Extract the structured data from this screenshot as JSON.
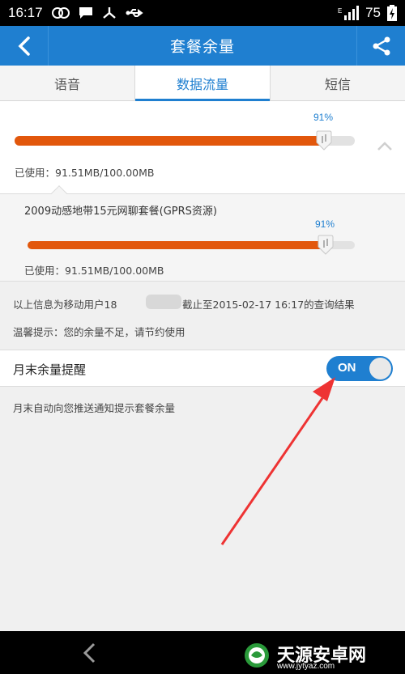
{
  "status_bar": {
    "time": "16:17",
    "battery": "75"
  },
  "app_bar": {
    "title": "套餐余量"
  },
  "tabs": [
    {
      "label": "语音",
      "active": false
    },
    {
      "label": "数据流量",
      "active": true
    },
    {
      "label": "短信",
      "active": false
    }
  ],
  "total": {
    "percent": "91%",
    "progress": 0.91,
    "used_text": "已使用：91.51MB/100.00MB"
  },
  "package": {
    "name": "2009动感地带15元网聊套餐(GPRS资源)",
    "percent": "91%",
    "progress": 0.91,
    "used_text": "已使用：91.51MB/100.00MB"
  },
  "info": {
    "query_prefix": "以上信息为移动用户18",
    "query_suffix": "截止至2015-02-17 16:17的查询结果",
    "tip": "温馨提示：您的余量不足，请节约使用"
  },
  "reminder": {
    "label": "月末余量提醒",
    "toggle_label": "ON",
    "on": true,
    "description": "月末自动向您推送通知提示套餐余量"
  },
  "watermark": {
    "name": "天源安卓网",
    "url": "www.jytyaz.com"
  },
  "colors": {
    "accent": "#1f7fd0",
    "progress": "#e2570c",
    "annotation_arrow": "#ee3333"
  }
}
